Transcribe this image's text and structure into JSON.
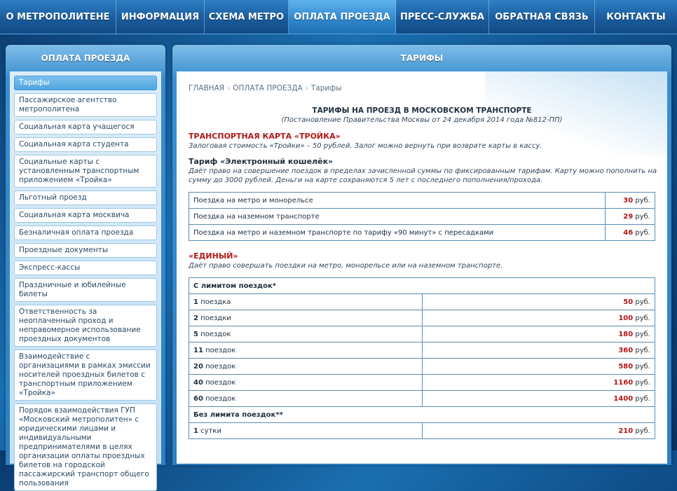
{
  "nav": [
    {
      "label": "О МЕТРОПОЛИТЕНЕ",
      "active": false
    },
    {
      "label": "ИНФОРМАЦИЯ",
      "active": false
    },
    {
      "label": "СХЕМА МЕТРО",
      "active": false
    },
    {
      "label": "ОПЛАТА ПРОЕЗДА",
      "active": true
    },
    {
      "label": "ПРЕСС-СЛУЖБА",
      "active": false
    },
    {
      "label": "ОБРАТНАЯ СВЯЗЬ",
      "active": false
    },
    {
      "label": "КОНТАКТЫ",
      "active": false
    }
  ],
  "sidebar": {
    "title": "ОПЛАТА ПРОЕЗДА",
    "items": [
      "Тарифы",
      "Пассажирское агентство метрополитена",
      "Социальная карта учащегося",
      "Социальная карта студента",
      "Социальные карты с установленным транспортным приложением «Тройка»",
      "Льготный проезд",
      "Социальная карта москвича",
      "Безналичная оплата проезда",
      "Проездные документы",
      "Экспресс-кассы",
      "Праздничные и юбилейные билеты",
      "Ответственность за неоплаченный проход и неправомерное использование проездных документов",
      "Взаимодействие с организациями в рамках эмиссии носителей проездных билетов с транспортным приложением «Тройка»",
      "Порядок взаимодействия ГУП «Московский метрополитен» с юридическими лицами и индивидуальными предпринимателями в целях организации оплаты проездных билетов на городской пассажирский транспорт общего пользования"
    ]
  },
  "main": {
    "title": "ТАРИФЫ",
    "breadcrumb": [
      "ГЛАВНАЯ",
      "ОПЛАТА ПРОЕЗДА",
      "Тарифы"
    ],
    "breadcrumb_sep": "›",
    "doc_title": "ТАРИФЫ НА ПРОЕЗД В МОСКОВСКОМ ТРАНСПОРТЕ",
    "doc_subtitle": "(Постановление Правительства Москвы от 24 декабря 2014 года №812-ПП)",
    "troika_heading": "ТРАНСПОРТНАЯ КАРТА «ТРОЙКА»",
    "troika_desc": "Залоговая стоимость «Тройки» – 50 рублей. Залог можно вернуть при возврате карты в кассу.",
    "wallet_heading": "Тариф «Электронный кошелёк»",
    "wallet_desc": "Даёт право на совершение поездок в пределах зачисленной суммы по фиксированным тарифам. Карту можно пополнить на сумму до 3000 рублей. Деньги на карте сохраняются 5 лет с последнего пополнения/прохода.",
    "currency": "руб.",
    "wallet_rows": [
      {
        "label": "Поездка на метро и монорельсе",
        "price": "30"
      },
      {
        "label": "Поездка на наземном транспорте",
        "price": "29"
      },
      {
        "label": "Поездка на метро и наземном транспорте по тарифу «90 минут» с пересадками",
        "price": "46"
      }
    ],
    "edinyi_heading": "«ЕДИНЫЙ»",
    "edinyi_desc": "Даёт право совершать поездки на метро, монорельсе или на наземном транспорте.",
    "limited_header": "С лимитом поездок*",
    "limited_rows": [
      {
        "num": "1",
        "unit": "поездка",
        "price": "50"
      },
      {
        "num": "2",
        "unit": "поездки",
        "price": "100"
      },
      {
        "num": "5",
        "unit": "поездок",
        "price": "180"
      },
      {
        "num": "11",
        "unit": "поездок",
        "price": "360"
      },
      {
        "num": "20",
        "unit": "поездок",
        "price": "580"
      },
      {
        "num": "40",
        "unit": "поездок",
        "price": "1160"
      },
      {
        "num": "60",
        "unit": "поездок",
        "price": "1400"
      }
    ],
    "unlimited_header": "Без лимита поездок**",
    "unlimited_rows": [
      {
        "num": "1",
        "unit": "сутки",
        "price": "210"
      }
    ]
  }
}
